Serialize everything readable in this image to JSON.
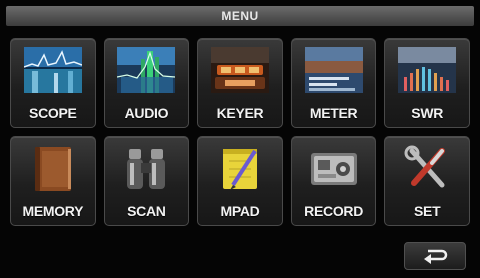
{
  "header": {
    "title": "MENU"
  },
  "menu": {
    "items": [
      {
        "label": "SCOPE",
        "icon": "spectrum-scope-icon"
      },
      {
        "label": "AUDIO",
        "icon": "audio-scope-icon"
      },
      {
        "label": "KEYER",
        "icon": "keyer-icon"
      },
      {
        "label": "METER",
        "icon": "meter-icon"
      },
      {
        "label": "SWR",
        "icon": "swr-graph-icon"
      },
      {
        "label": "MEMORY",
        "icon": "memory-book-icon"
      },
      {
        "label": "SCAN",
        "icon": "binoculars-icon"
      },
      {
        "label": "MPAD",
        "icon": "memo-pad-icon"
      },
      {
        "label": "RECORD",
        "icon": "recorder-icon"
      },
      {
        "label": "SET",
        "icon": "tools-icon"
      }
    ]
  },
  "controls": {
    "back_icon": "return-arrow-icon"
  },
  "colors": {
    "background": "#050505",
    "tile": "#2a2a2a",
    "label": "#f2f2f2",
    "scope_accent": "#3fb7e6",
    "audio_accent": "#3ad07a",
    "keyer_accent": "#c85a1e",
    "mpad_accent": "#e8d43a",
    "memory_accent": "#8a4a22"
  }
}
